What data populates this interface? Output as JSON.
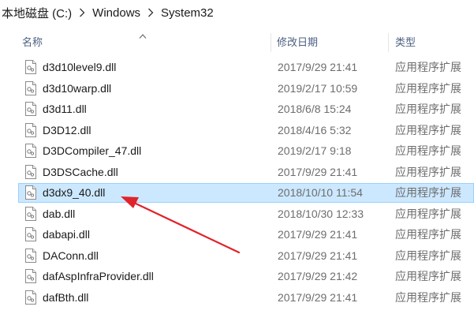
{
  "breadcrumb": {
    "items": [
      "本地磁盘 (C:)",
      "Windows",
      "System32"
    ]
  },
  "columns": {
    "name": "名称",
    "date": "修改日期",
    "type": "类型"
  },
  "files": [
    {
      "name": "d3d10level9.dll",
      "date": "2017/9/29 21:41",
      "type": "应用程序扩展"
    },
    {
      "name": "d3d10warp.dll",
      "date": "2019/2/17 10:59",
      "type": "应用程序扩展"
    },
    {
      "name": "d3d11.dll",
      "date": "2018/6/8 15:24",
      "type": "应用程序扩展"
    },
    {
      "name": "D3D12.dll",
      "date": "2018/4/16 5:32",
      "type": "应用程序扩展"
    },
    {
      "name": "D3DCompiler_47.dll",
      "date": "2019/2/17 9:18",
      "type": "应用程序扩展"
    },
    {
      "name": "D3DSCache.dll",
      "date": "2017/9/29 21:41",
      "type": "应用程序扩展"
    },
    {
      "name": "d3dx9_40.dll",
      "date": "2018/10/10 11:54",
      "type": "应用程序扩展",
      "selected": true
    },
    {
      "name": "dab.dll",
      "date": "2018/10/30 12:33",
      "type": "应用程序扩展"
    },
    {
      "name": "dabapi.dll",
      "date": "2017/9/29 21:41",
      "type": "应用程序扩展"
    },
    {
      "name": "DAConn.dll",
      "date": "2017/9/29 21:41",
      "type": "应用程序扩展"
    },
    {
      "name": "dafAspInfraProvider.dll",
      "date": "2017/9/29 21:42",
      "type": "应用程序扩展"
    },
    {
      "name": "dafBth.dll",
      "date": "2017/9/29 21:41",
      "type": "应用程序扩展"
    }
  ],
  "colors": {
    "selection_fill": "#cce8ff",
    "selection_border": "#99d1ff",
    "annotation_arrow": "#e0232b",
    "header_text": "#4d6082"
  },
  "icons": {
    "file": "dll-file-icon",
    "separator": "chevron-right-icon",
    "sort": "sort-up-icon"
  }
}
